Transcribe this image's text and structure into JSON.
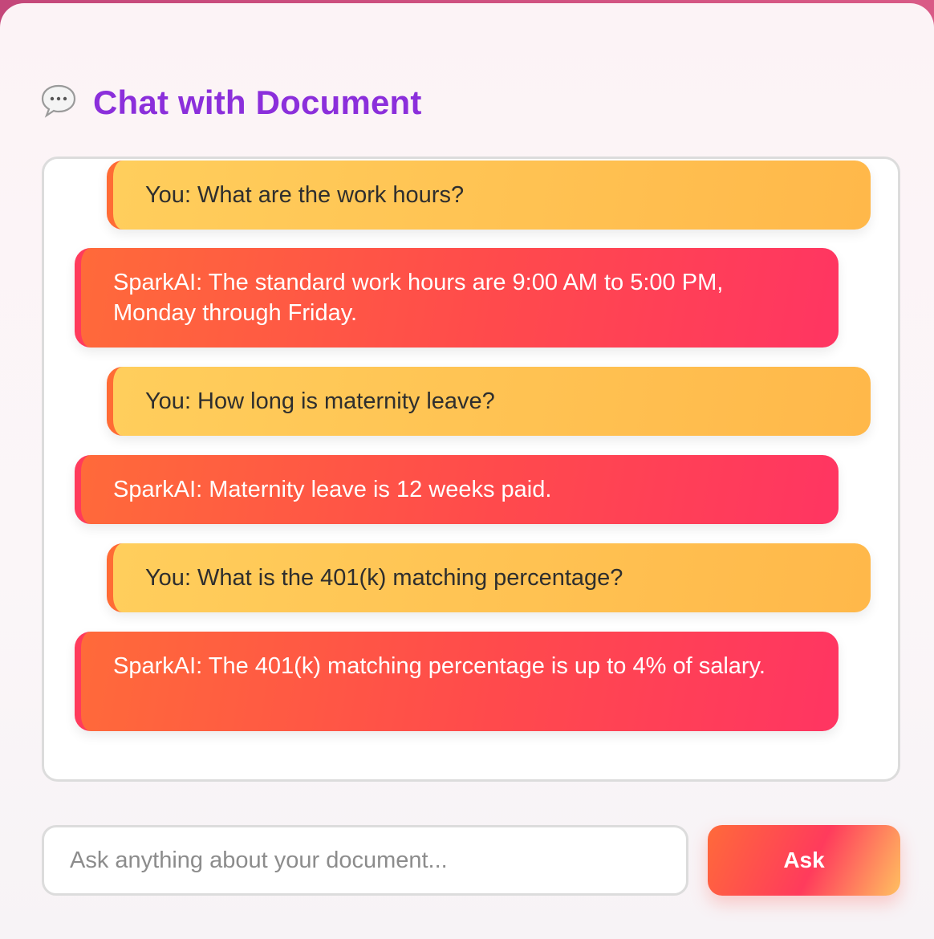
{
  "header": {
    "icon": "speech-bubble-icon",
    "title": "Chat with Document"
  },
  "messages": [
    {
      "role": "user",
      "text": "You: What are the work hours?"
    },
    {
      "role": "ai",
      "text": "SparkAI: The standard work hours are 9:00 AM to 5:00 PM, Monday through Friday."
    },
    {
      "role": "user",
      "text": "You: How long is maternity leave?"
    },
    {
      "role": "ai",
      "text": "SparkAI: Maternity leave is 12 weeks paid."
    },
    {
      "role": "user",
      "text": "You: What is the 401(k) matching percentage?"
    },
    {
      "role": "ai",
      "text": "SparkAI: The 401(k) matching percentage is up to 4% of salary."
    }
  ],
  "input": {
    "placeholder": "Ask anything about your document...",
    "value": ""
  },
  "ask_button": {
    "label": "Ask"
  },
  "colors": {
    "title": "#8b2fdb",
    "user_bubble": "#ffc454",
    "ai_bubble": "#ff4a4c",
    "frame": "#c4477a"
  }
}
